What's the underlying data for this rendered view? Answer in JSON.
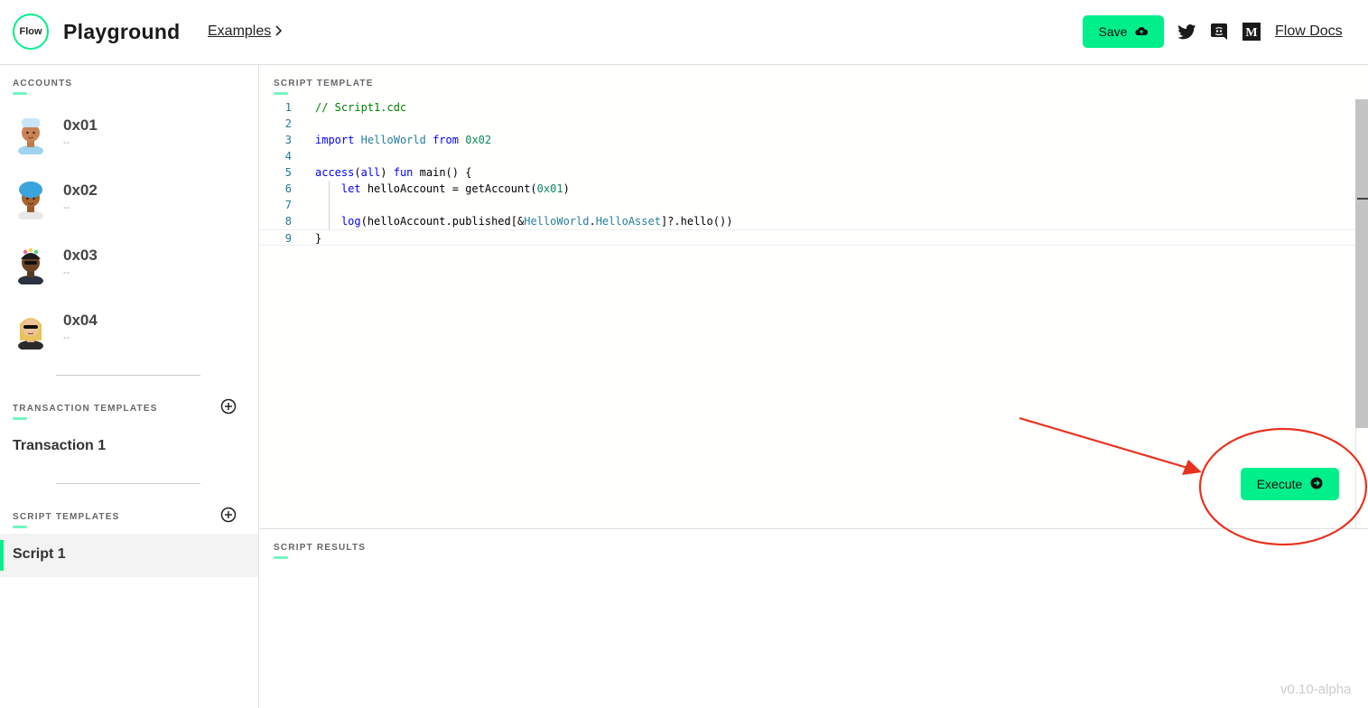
{
  "header": {
    "logo_text": "Flow",
    "title": "Playground",
    "examples_label": "Examples",
    "save_label": "Save",
    "docs_label": "Flow Docs"
  },
  "sidebar": {
    "accounts_label": "ACCOUNTS",
    "accounts": [
      {
        "address": "0x01",
        "balance": "--"
      },
      {
        "address": "0x02",
        "balance": "--"
      },
      {
        "address": "0x03",
        "balance": "--"
      },
      {
        "address": "0x04",
        "balance": "--"
      }
    ],
    "transaction_templates_label": "TRANSACTION TEMPLATES",
    "transactions": [
      "Transaction 1"
    ],
    "script_templates_label": "SCRIPT TEMPLATES",
    "scripts": [
      "Script 1"
    ]
  },
  "editor": {
    "label": "SCRIPT TEMPLATE",
    "line_numbers": [
      "1",
      "2",
      "3",
      "4",
      "5",
      "6",
      "7",
      "8",
      "9"
    ],
    "execute_label": "Execute"
  },
  "results": {
    "label": "SCRIPT RESULTS"
  },
  "version": "v0.10-alpha",
  "colors": {
    "accent": "#00ef8b",
    "annotation": "#e8321f"
  }
}
